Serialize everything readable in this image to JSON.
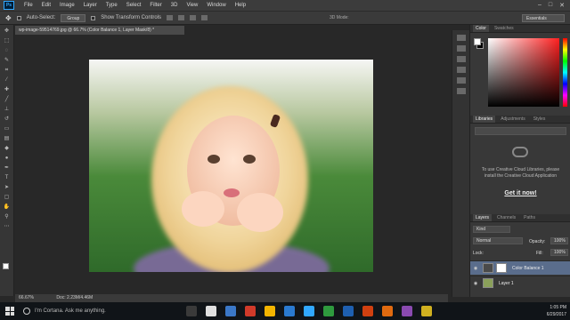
{
  "app": {
    "logo": "Ps"
  },
  "menu": [
    "File",
    "Edit",
    "Image",
    "Layer",
    "Type",
    "Select",
    "Filter",
    "3D",
    "View",
    "Window",
    "Help"
  ],
  "options": {
    "auto_select": "Auto-Select:",
    "group": "Group",
    "show_transform": "Show Transform Controls",
    "mode3d": "3D Mode:",
    "workspace": "Essentials"
  },
  "document": {
    "tab_title": "wp-image-59514769.jpg @ 66.7% (Color Balance 1, Layer Mask/8) *",
    "zoom": "66.67%",
    "doc_info": "Doc: 2.23M/4.46M"
  },
  "panels": {
    "color_tabs": [
      "Color",
      "Swatches"
    ],
    "library_tabs": [
      "Libraries",
      "Adjustments",
      "Styles"
    ],
    "library_message": "To use Creative Cloud Libraries, please install the Creative Cloud Application",
    "library_link": "Get it now!",
    "layers_tabs": [
      "Layers",
      "Channels",
      "Paths"
    ],
    "kind": "Kind",
    "blend_mode": "Normal",
    "opacity_label": "Opacity:",
    "opacity_value": "100%",
    "lock_label": "Lock:",
    "fill_label": "Fill:",
    "fill_value": "100%",
    "layers": [
      {
        "name": "Color Balance 1",
        "selected": true
      },
      {
        "name": "Layer 1",
        "selected": false
      }
    ]
  },
  "taskbar": {
    "cortana_placeholder": "I'm Cortana. Ask me anything.",
    "time": "1:05 PM",
    "date": "6/29/2017",
    "app_colors": [
      "#3a3a3a",
      "#e0e0e0",
      "#3b78c8",
      "#d03a2a",
      "#f2b400",
      "#2a7ad0",
      "#31a8ff",
      "#2e9a3e",
      "#1e5fb0",
      "#d04010",
      "#e06a10",
      "#8a4ab0",
      "#d0b020"
    ]
  }
}
